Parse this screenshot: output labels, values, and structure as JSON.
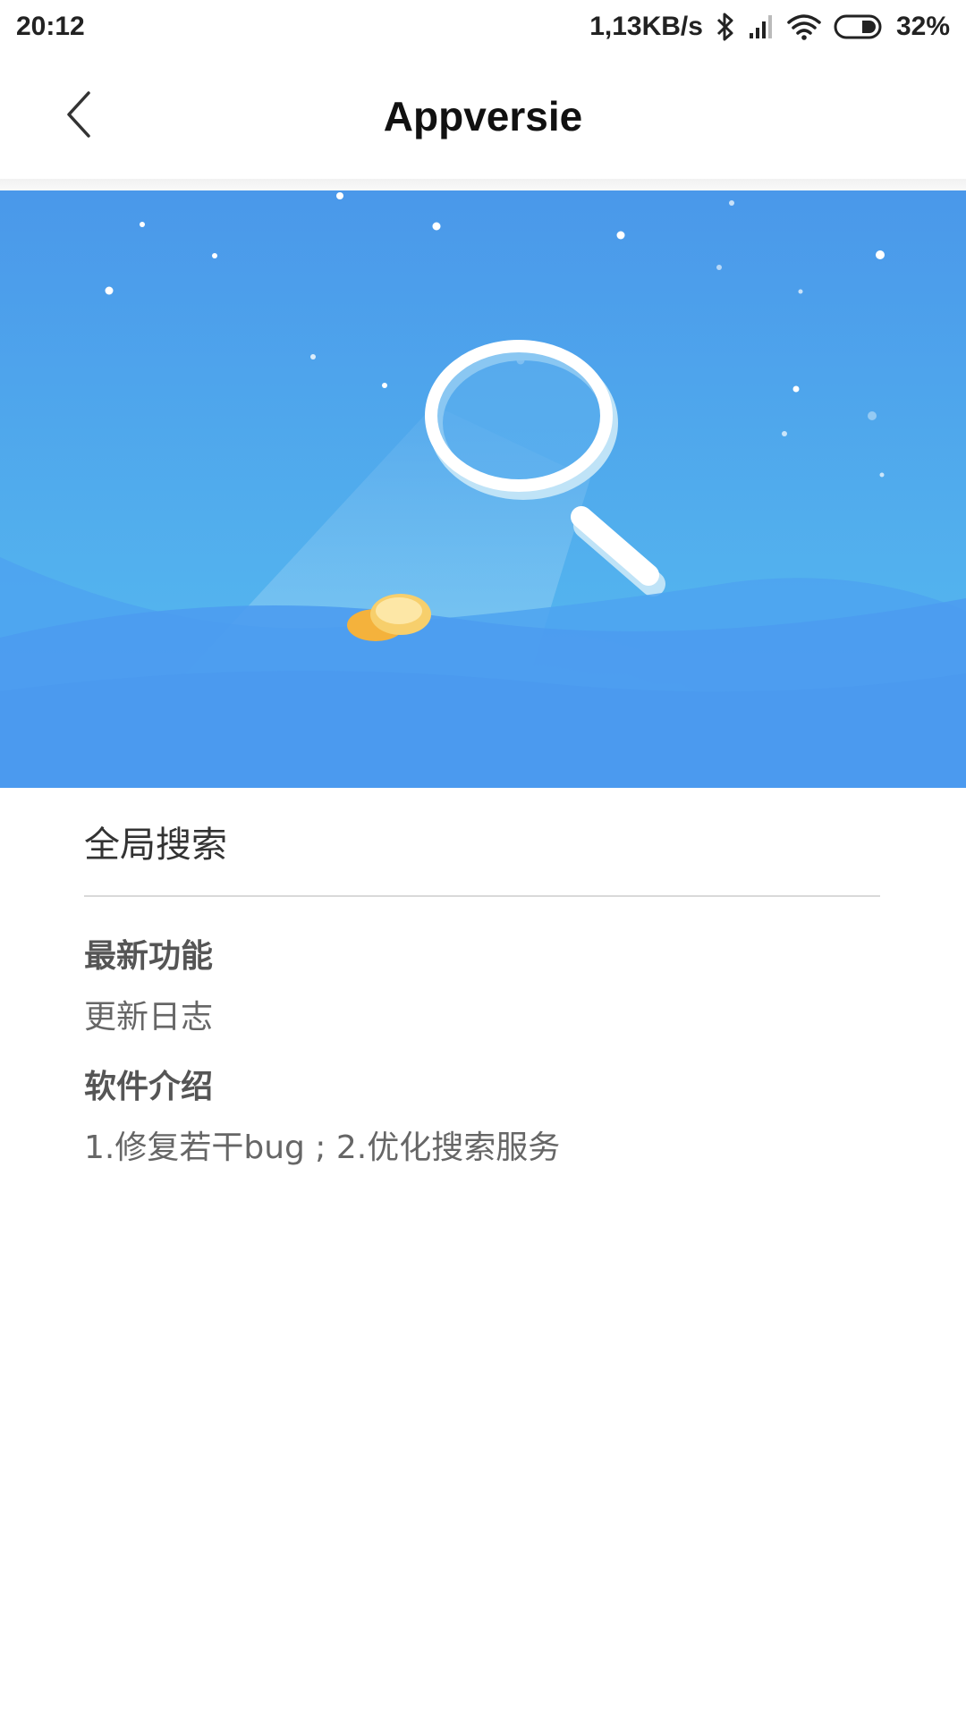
{
  "status_bar": {
    "time": "20:12",
    "network_speed": "1,13KB/s",
    "battery": "32%",
    "icons": [
      "bluetooth-icon",
      "signal-icon",
      "wifi-icon",
      "battery-icon"
    ]
  },
  "header": {
    "title": "Appversie",
    "back_icon": "chevron-left-icon"
  },
  "banner": {
    "illustration": "magnifying-glass-search-illustration",
    "colors": {
      "sky_top": "#4a99ea",
      "sky_bottom": "#5ec6f2",
      "wave": "#4d9ff0"
    }
  },
  "app": {
    "name": "全局搜索"
  },
  "sections": [
    {
      "heading": "最新功能",
      "text": "更新日志"
    },
    {
      "heading": "软件介绍",
      "text": "1.修复若干bug ; 2.优化搜索服务"
    }
  ]
}
